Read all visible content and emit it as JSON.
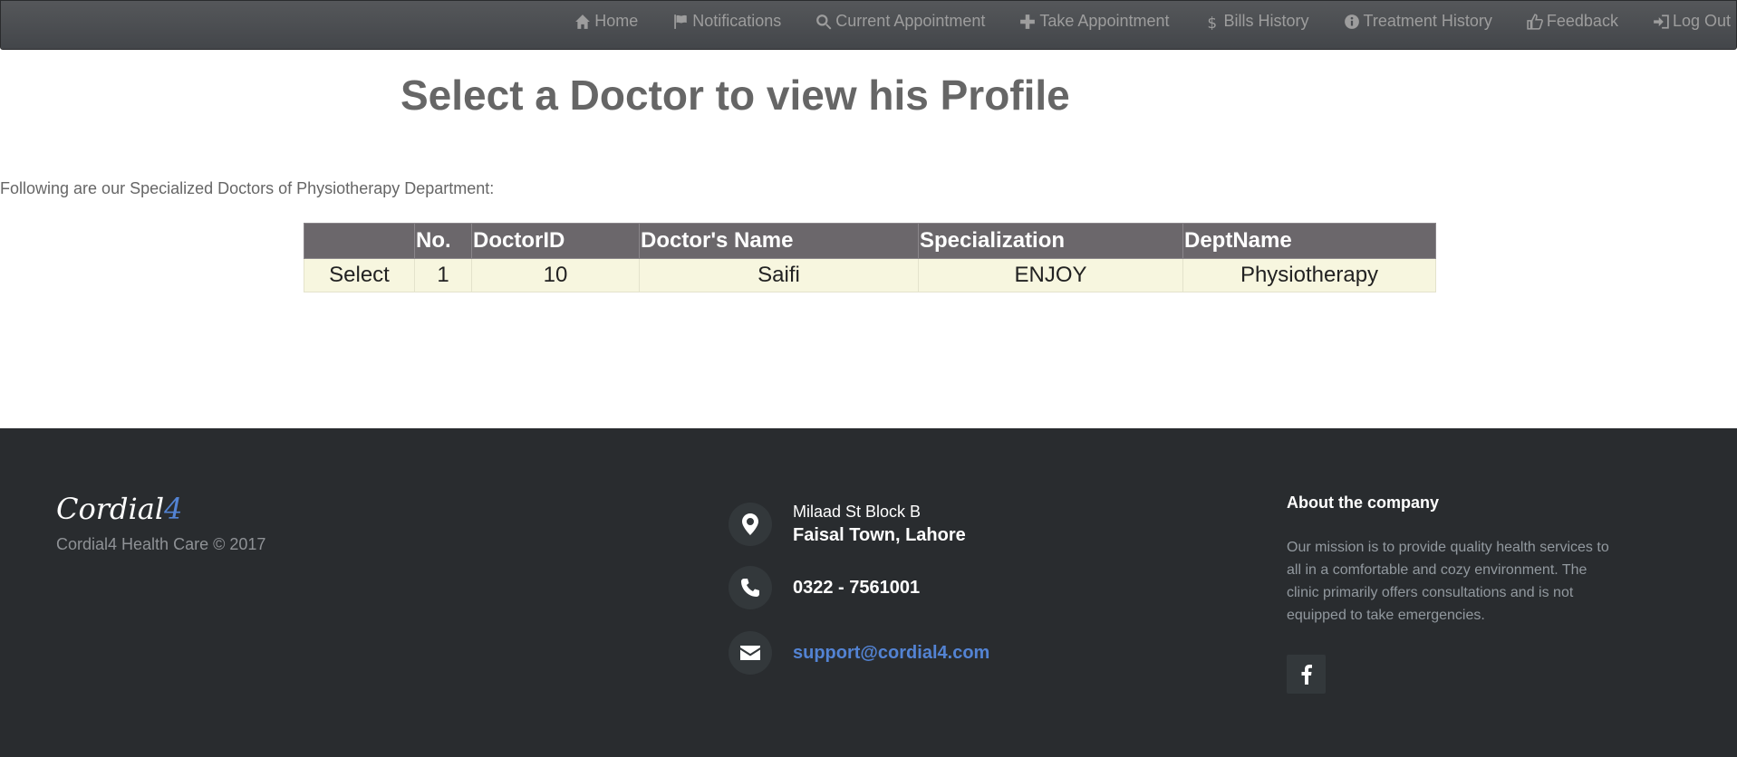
{
  "nav": {
    "items": [
      {
        "label": "Home",
        "icon": "home-icon"
      },
      {
        "label": "Notifications",
        "icon": "flag-icon"
      },
      {
        "label": "Current Appointment",
        "icon": "search-icon"
      },
      {
        "label": "Take Appointment",
        "icon": "plus-icon"
      },
      {
        "label": "Bills History",
        "icon": "dollar-icon"
      },
      {
        "label": "Treatment History",
        "icon": "info-icon"
      },
      {
        "label": "Feedback",
        "icon": "thumbs-up-icon"
      },
      {
        "label": "Log Out",
        "icon": "log-out-icon"
      }
    ]
  },
  "main": {
    "title": "Select a Doctor to view his Profile",
    "intro": "Following are our Specialized Doctors of Physiotherapy Department:",
    "table": {
      "headers": [
        "",
        "No.",
        "DoctorID",
        "Doctor's Name",
        "Specialization",
        "DeptName"
      ],
      "rows": [
        {
          "action": "Select",
          "no": "1",
          "doctor_id": "10",
          "name": "Saifi",
          "specialization": "ENJOY",
          "dept": "Physiotherapy"
        }
      ]
    }
  },
  "footer": {
    "logo_text": "Cordial",
    "logo_num": "4",
    "copyright": "Cordial4 Health Care © 2017",
    "address_line1": "Milaad St Block B",
    "address_line2": "Faisal Town, Lahore",
    "phone": "0322 - 7561001",
    "email": "support@cordial4.com",
    "about_title": "About the company",
    "about_text": "Our mission is to provide quality health services to all in a comfortable and cozy environment. The clinic primarily offers consultations and is not equipped to take emergencies."
  },
  "colors": {
    "navbar": "#4b4e52",
    "table_header": "#6b676b",
    "table_row": "#f7f6df",
    "footer": "#292c2f",
    "accent": "#5383d3"
  }
}
